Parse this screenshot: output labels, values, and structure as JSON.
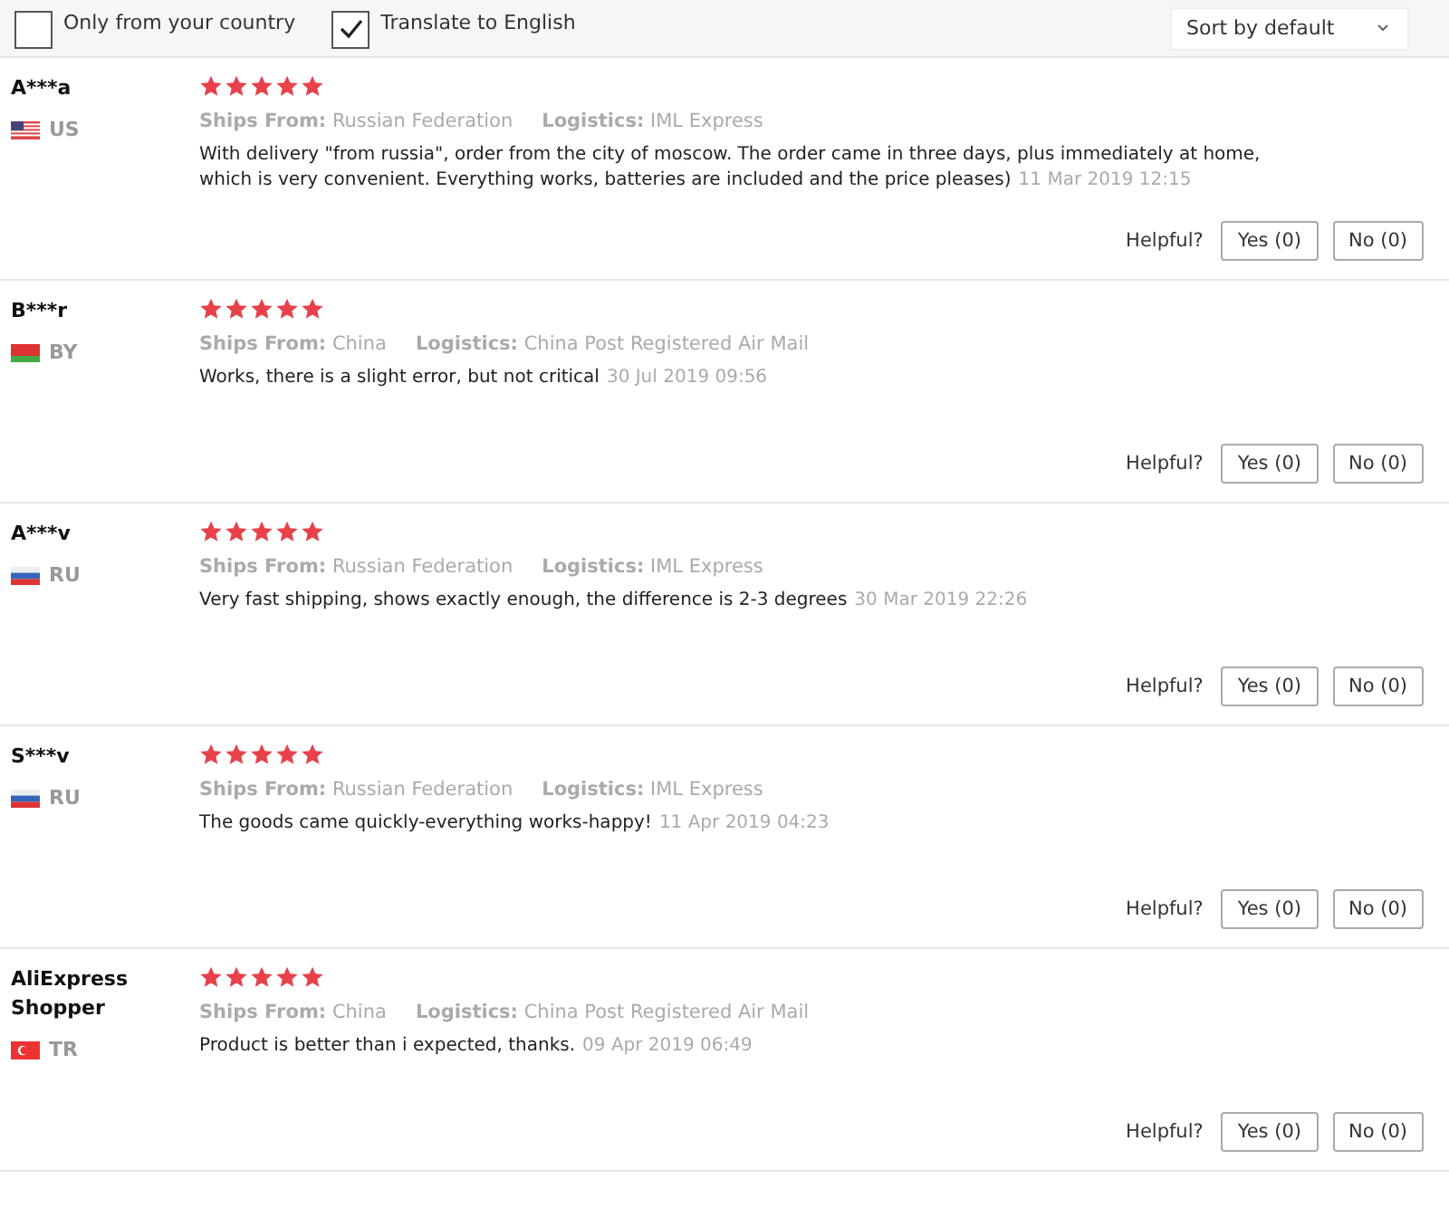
{
  "filters": [
    {
      "label": "Only from your country",
      "checked": false
    },
    {
      "label": "Translate to English",
      "checked": true
    }
  ],
  "sort": {
    "value": "Sort by default"
  },
  "reviews": [
    {
      "name": "A***a",
      "country": "US",
      "flag": {
        "kind": "us"
      },
      "stars": 5,
      "ships_label": "Ships From:",
      "ships_from": "Russian Federation",
      "logistics_label": "Logistics:",
      "logistics": "IML Express",
      "text": "With delivery \"from russia\", order from the city of moscow. The order came in three days, plus immediately at home, which is very convenient. Everything works, batteries are included and the price pleases)",
      "date": "11 Mar 2019 12:15",
      "helpful": "Helpful?",
      "yes": "Yes (0)",
      "no": "No (0)"
    },
    {
      "name": "B***r",
      "country": "BY",
      "flag": {
        "kind": "by"
      },
      "stars": 5,
      "ships_label": "Ships From:",
      "ships_from": "China",
      "logistics_label": "Logistics:",
      "logistics": "China Post Registered Air Mail",
      "text": "Works, there is a slight error, but not critical",
      "date": "30 Jul 2019 09:56",
      "helpful": "Helpful?",
      "yes": "Yes (0)",
      "no": "No (0)"
    },
    {
      "name": "A***v",
      "country": "RU",
      "flag": {
        "kind": "ru"
      },
      "stars": 5,
      "ships_label": "Ships From:",
      "ships_from": "Russian Federation",
      "logistics_label": "Logistics:",
      "logistics": "IML Express",
      "text": "Very fast shipping, shows exactly enough, the difference is 2-3 degrees",
      "date": "30 Mar 2019 22:26",
      "helpful": "Helpful?",
      "yes": "Yes (0)",
      "no": "No (0)"
    },
    {
      "name": "S***v",
      "country": "RU",
      "flag": {
        "kind": "ru"
      },
      "stars": 5,
      "ships_label": "Ships From:",
      "ships_from": "Russian Federation",
      "logistics_label": "Logistics:",
      "logistics": "IML Express",
      "text": "The goods came quickly-everything works-happy!",
      "date": "11 Apr 2019 04:23",
      "helpful": "Helpful?",
      "yes": "Yes (0)",
      "no": "No (0)"
    },
    {
      "name": "AliExpress Shopper",
      "country": "TR",
      "flag": {
        "kind": "tr"
      },
      "stars": 5,
      "ships_label": "Ships From:",
      "ships_from": "China",
      "logistics_label": "Logistics:",
      "logistics": "China Post Registered Air Mail",
      "text": "Product is better than i expected, thanks.",
      "date": "09 Apr 2019 06:49",
      "helpful": "Helpful?",
      "yes": "Yes (0)",
      "no": "No (0)"
    }
  ]
}
